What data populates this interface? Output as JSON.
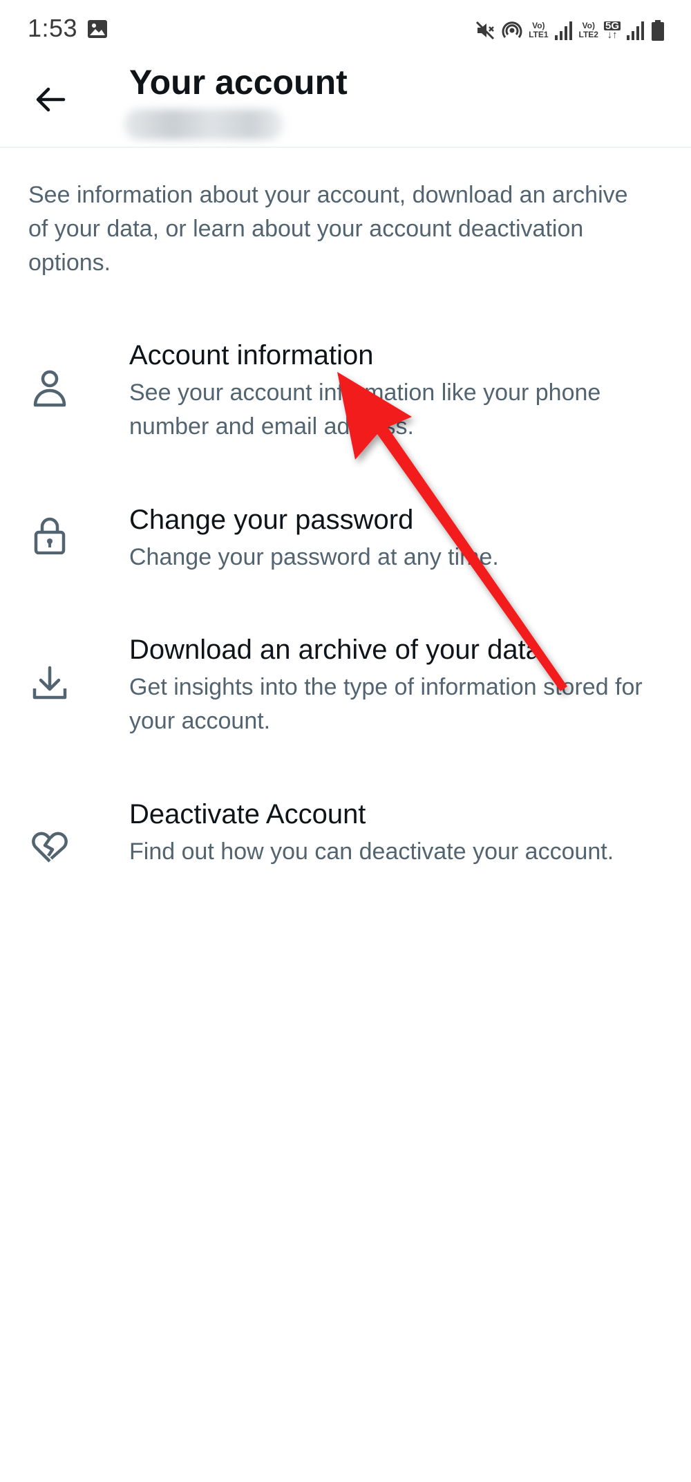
{
  "status_bar": {
    "time": "1:53",
    "icons": [
      "gallery-icon",
      "mute-icon",
      "hotspot-icon",
      "volte-lte1-icon",
      "signal-icon",
      "volte-lte2-icon",
      "5g-icon",
      "signal-icon",
      "battery-icon"
    ],
    "tags": {
      "lte1_top": "Vo)",
      "lte1_bottom": "LTE1",
      "lte2_top": "Vo)",
      "lte2_bottom": "LTE2",
      "network": "5G"
    }
  },
  "header": {
    "title": "Your account"
  },
  "intro": "See information about your account, download an archive of your data, or learn about your account deactivation options.",
  "items": [
    {
      "icon": "person-icon",
      "title": "Account information",
      "description": "See your account information like your phone number and email address."
    },
    {
      "icon": "lock-icon",
      "title": "Change your password",
      "description": "Change your password at any time."
    },
    {
      "icon": "download-icon",
      "title": "Download an archive of your data",
      "description": "Get insights into the type of information stored for your account."
    },
    {
      "icon": "broken-heart-icon",
      "title": "Deactivate Account",
      "description": "Find out how you can deactivate your account."
    }
  ],
  "colors": {
    "primary_text": "#0f1419",
    "secondary_text": "#536471",
    "divider": "#eff3f4",
    "annotation_arrow": "#f21c1c"
  }
}
